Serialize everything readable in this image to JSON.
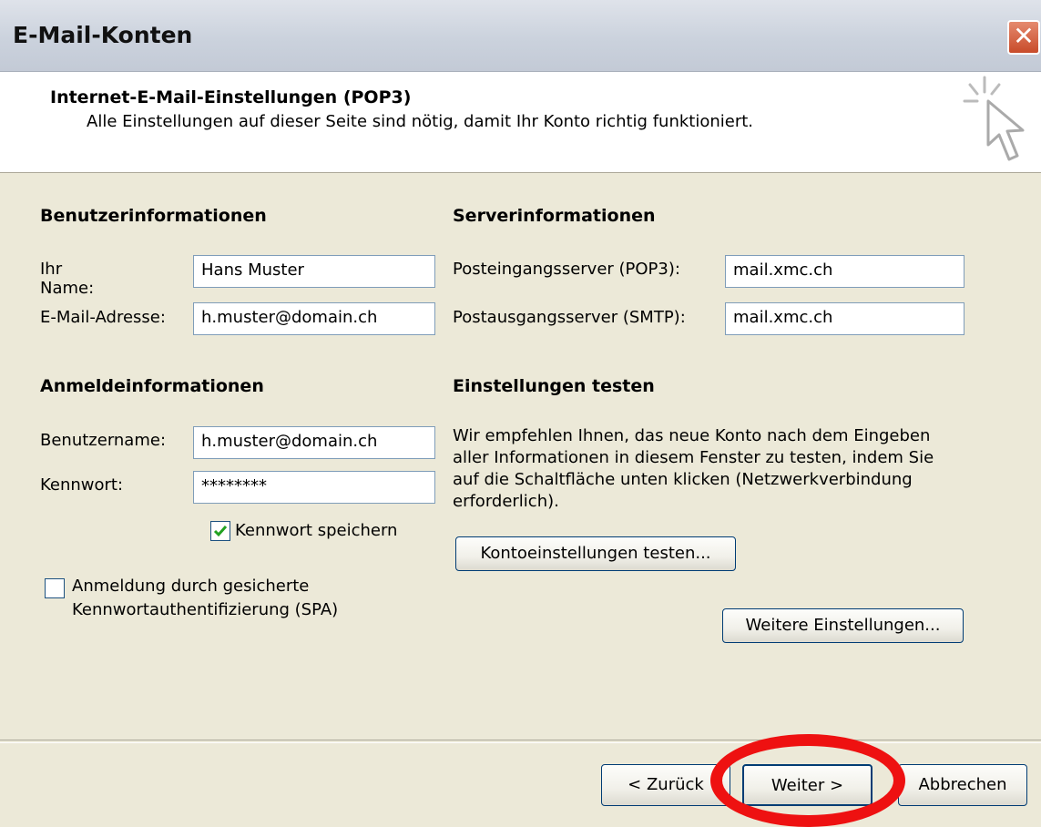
{
  "window": {
    "title": "E-Mail-Konten",
    "close_symbol": "✕"
  },
  "header": {
    "title": "Internet-E-Mail-Einstellungen (POP3)",
    "subtitle": "Alle Einstellungen auf dieser Seite sind nötig, damit Ihr Konto richtig funktioniert.",
    "icon": "wizard-cursor-icon"
  },
  "user_info": {
    "heading": "Benutzerinformationen",
    "name_label": "Ihr Name:",
    "name_value": "Hans Muster",
    "email_label": "E-Mail-Adresse:",
    "email_value": "h.muster@domain.ch"
  },
  "server_info": {
    "heading": "Serverinformationen",
    "incoming_label": "Posteingangsserver (POP3):",
    "incoming_value": "mail.xmc.ch",
    "outgoing_label": "Postausgangsserver (SMTP):",
    "outgoing_value": "mail.xmc.ch"
  },
  "login_info": {
    "heading": "Anmeldeinformationen",
    "username_label": "Benutzername:",
    "username_value": "h.muster@domain.ch",
    "password_label": "Kennwort:",
    "password_value": "********",
    "save_password_label": "Kennwort speichern",
    "save_password_checked": true,
    "spa_label_line1": "Anmeldung durch gesicherte",
    "spa_label_line2": "Kennwortauthentifizierung (SPA)",
    "spa_checked": false
  },
  "test_settings": {
    "heading": "Einstellungen testen",
    "description": "Wir empfehlen Ihnen, das neue Konto nach dem Eingeben aller Informationen in diesem Fenster zu testen, indem Sie auf die Schaltfläche unten klicken (Netzwerkverbindung erforderlich).",
    "test_button": "Kontoeinstellungen testen...",
    "more_settings_button": "Weitere Einstellungen..."
  },
  "footer": {
    "back_button": "< Zurück",
    "next_button": "Weiter >",
    "cancel_button": "Abbrechen"
  },
  "colors": {
    "highlight_circle": "#ee1111",
    "dialog_bg": "#ece9d8",
    "close_button": "#c84b2a"
  }
}
